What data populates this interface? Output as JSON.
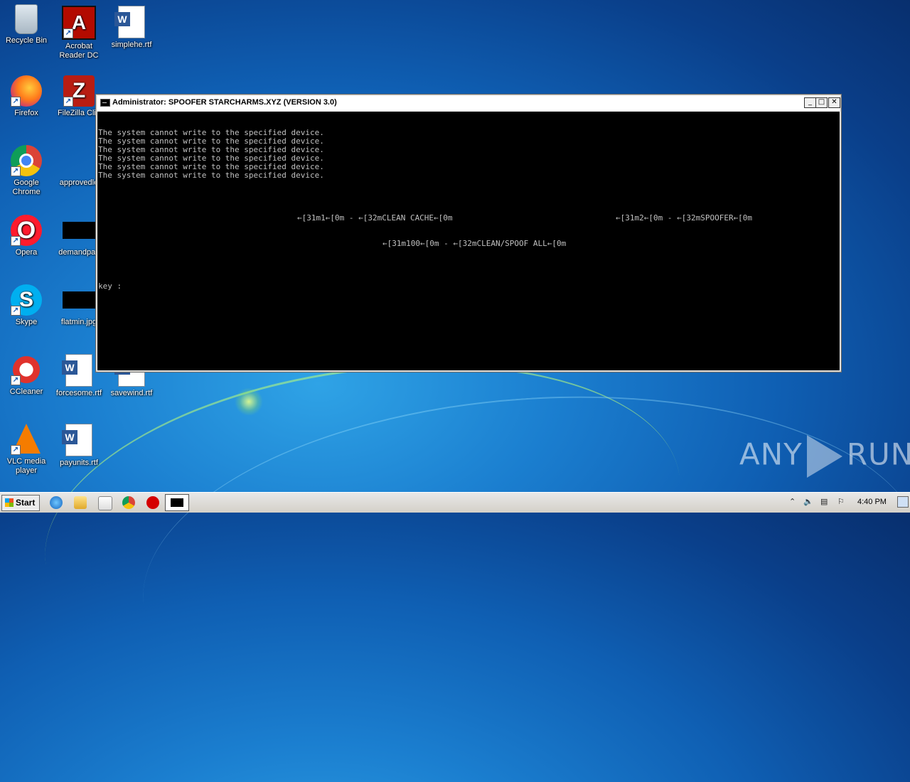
{
  "desktop": {
    "icons": [
      {
        "label": "Recycle Bin"
      },
      {
        "label": "Acrobat Reader DC"
      },
      {
        "label": "simplehe.rtf"
      },
      {
        "label": "Firefox"
      },
      {
        "label": "FileZilla Clie"
      },
      {
        "label": "Google Chrome"
      },
      {
        "label": "approvedle"
      },
      {
        "label": "Opera"
      },
      {
        "label": "demandpac"
      },
      {
        "label": "Skype"
      },
      {
        "label": "flatmin.jpg"
      },
      {
        "label": "CCleaner"
      },
      {
        "label": "forcesome.rtf"
      },
      {
        "label": "savewind.rtf"
      },
      {
        "label": "VLC media player"
      },
      {
        "label": "payunits.rtf"
      }
    ]
  },
  "window": {
    "title": "Administrator:  SPOOFER STARCHARMS.XYZ (VERSION 3.0)",
    "minimize": "_",
    "maximize": "□",
    "close": "✕"
  },
  "console": {
    "lines": [
      "The system cannot write to the specified device.",
      "The system cannot write to the specified device.",
      "The system cannot write to the specified device.",
      "The system cannot write to the specified device.",
      "The system cannot write to the specified device.",
      "The system cannot write to the specified device."
    ],
    "option1": "←[31m1←[0m - ←[32mCLEAN CACHE←[0m",
    "option2": "←[31m2←[0m - ←[32mSPOOFER←[0m",
    "option100": "←[31m100←[0m - ←[32mCLEAN/SPOOF ALL←[0m",
    "prompt": "key :"
  },
  "taskbar": {
    "start_label": "Start",
    "clock": "4:40 PM"
  },
  "watermark": {
    "left": "ANY",
    "right": "RUN"
  }
}
